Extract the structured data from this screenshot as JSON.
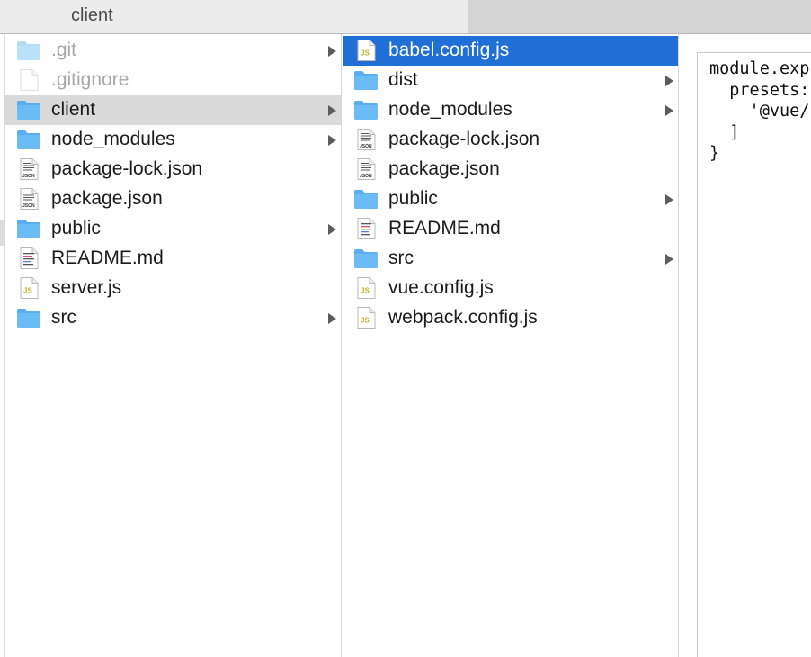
{
  "window": {
    "tabs": [
      {
        "label": "client",
        "active": true
      },
      {
        "label": "",
        "active": false
      }
    ]
  },
  "columns": [
    {
      "items": [
        {
          "label": ".git",
          "icon": "folder-icon",
          "has_children": true,
          "dim": true
        },
        {
          "label": ".gitignore",
          "icon": "document-icon",
          "has_children": false,
          "dim": true
        },
        {
          "label": "client",
          "icon": "folder-icon",
          "has_children": true,
          "selected": "inactive"
        },
        {
          "label": "node_modules",
          "icon": "folder-icon",
          "has_children": true
        },
        {
          "label": "package-lock.json",
          "icon": "json-file-icon",
          "has_children": false
        },
        {
          "label": "package.json",
          "icon": "json-file-icon",
          "has_children": false
        },
        {
          "label": "public",
          "icon": "folder-icon",
          "has_children": true
        },
        {
          "label": "README.md",
          "icon": "markdown-file-icon",
          "has_children": false
        },
        {
          "label": "server.js",
          "icon": "js-file-icon",
          "has_children": false
        },
        {
          "label": "src",
          "icon": "folder-icon",
          "has_children": true
        }
      ]
    },
    {
      "items": [
        {
          "label": "babel.config.js",
          "icon": "js-file-icon",
          "has_children": false,
          "selected": "active"
        },
        {
          "label": "dist",
          "icon": "folder-icon",
          "has_children": true
        },
        {
          "label": "node_modules",
          "icon": "folder-icon",
          "has_children": true
        },
        {
          "label": "package-lock.json",
          "icon": "json-file-icon",
          "has_children": false
        },
        {
          "label": "package.json",
          "icon": "json-file-icon",
          "has_children": false
        },
        {
          "label": "public",
          "icon": "folder-icon",
          "has_children": true
        },
        {
          "label": "README.md",
          "icon": "markdown-file-icon",
          "has_children": false
        },
        {
          "label": "src",
          "icon": "folder-icon",
          "has_children": true
        },
        {
          "label": "vue.config.js",
          "icon": "js-file-icon",
          "has_children": false
        },
        {
          "label": "webpack.config.js",
          "icon": "js-file-icon",
          "has_children": false
        }
      ]
    }
  ],
  "preview": {
    "code_lines": [
      "module.exp",
      "  presets:",
      "    '@vue/",
      "  ]",
      "}"
    ]
  },
  "colors": {
    "selection_active": "#1f6fd6",
    "selection_inactive": "#dadada",
    "folder": "#6bbcf5",
    "dimmed_text": "#a7a7a7",
    "js_badge": "#c4b02e"
  }
}
